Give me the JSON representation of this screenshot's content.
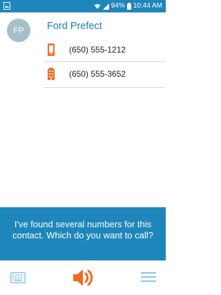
{
  "status_bar": {
    "battery_percent": "94%",
    "time": "10:44 AM"
  },
  "contact": {
    "initials": "FP",
    "name": "Ford Prefect"
  },
  "phone_numbers": [
    {
      "icon": "mobile-phone-icon",
      "number": "(650) 555-1212"
    },
    {
      "icon": "office-building-icon",
      "number": "(650) 555-3652"
    }
  ],
  "assistant_message": "I've found several numbers for this contact. Which do you want to call?",
  "bottom_bar": {
    "left_icon": "keyboard-icon",
    "center_icon": "speaker-icon",
    "right_icon": "menu-icon"
  },
  "colors": {
    "primary_blue": "#1e86bb",
    "accent_orange": "#f26a1f",
    "avatar_gray": "#a6bfc9"
  }
}
